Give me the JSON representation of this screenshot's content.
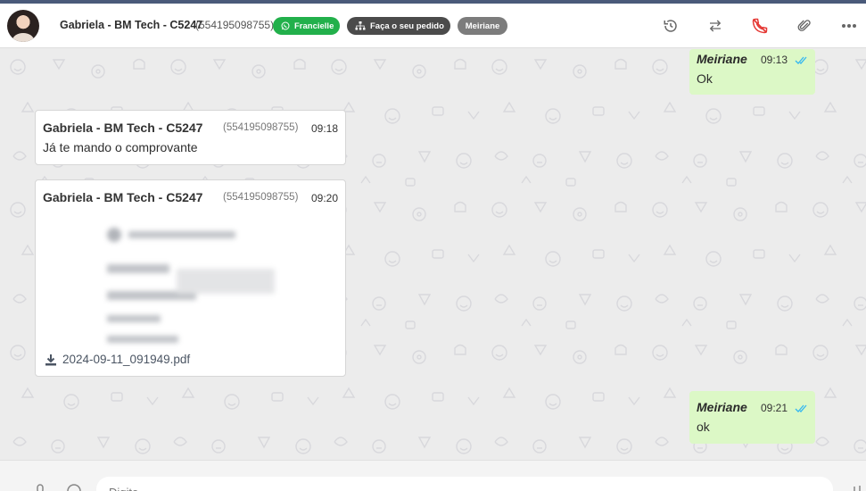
{
  "header": {
    "contact_name": "Gabriela - BM Tech - C5247",
    "contact_phone": "(554195098755)",
    "tags": [
      {
        "label": "Francielle",
        "color": "#22b04b",
        "icon": "whatsapp-icon"
      },
      {
        "label": "Faça o seu pedido",
        "color": "#4b4b4b",
        "icon": "sitemap-icon"
      },
      {
        "label": "Meiriane",
        "color": "#7c7c7c"
      }
    ],
    "actions": [
      "history-icon",
      "transfer-icon",
      "end-call-icon",
      "paperclip-icon",
      "more-options-icon"
    ]
  },
  "messages": [
    {
      "direction": "out",
      "sender": "Meiriane",
      "time": "09:13",
      "text": "Ok",
      "status": "read"
    },
    {
      "direction": "in",
      "sender": "Gabriela - BM Tech - C5247",
      "phone": "(554195098755)",
      "time": "09:18",
      "text": "Já te mando o comprovante"
    },
    {
      "direction": "in",
      "sender": "Gabriela - BM Tech - C5247",
      "phone": "(554195098755)",
      "time": "09:20",
      "attachment": "2024-09-11_091949.pdf"
    },
    {
      "direction": "out",
      "sender": "Meiriane",
      "time": "09:21",
      "text": "ok",
      "status": "read"
    }
  ],
  "composer": {
    "placeholder": "Digite..."
  },
  "colors": {
    "accent_blue": "#34b7f1",
    "outgoing_bubble": "#dcf8c6",
    "end_call_red": "#e53935"
  }
}
